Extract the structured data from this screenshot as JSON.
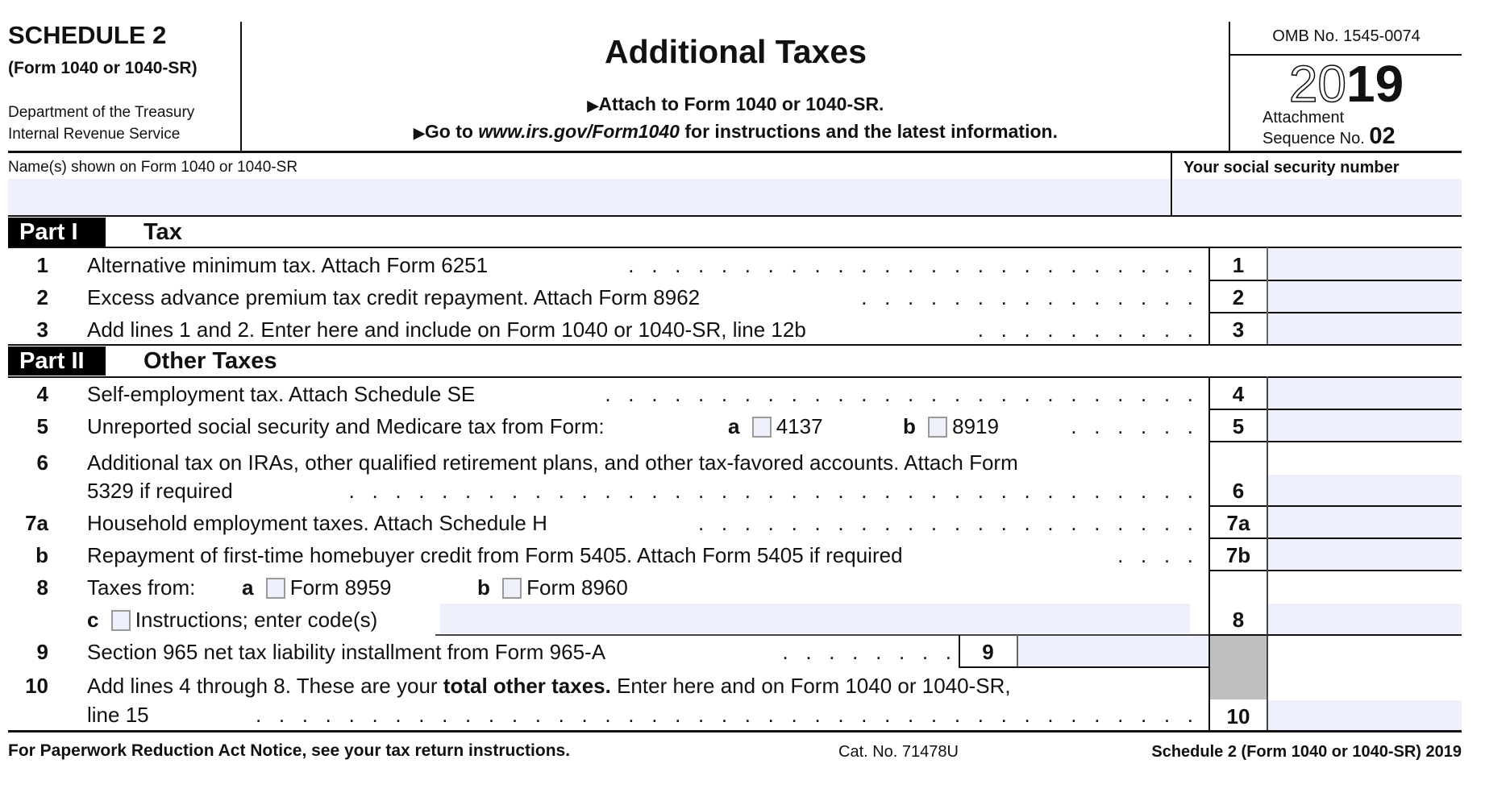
{
  "header": {
    "schedule": "SCHEDULE 2",
    "form_ref": "(Form 1040 or 1040-SR)",
    "dept_line1": "Department of the Treasury",
    "dept_line2": "Internal Revenue Service",
    "title": "Additional Taxes",
    "attach_line": "Attach to Form 1040 or 1040-SR.",
    "goto_prefix": "Go to ",
    "goto_url": "www.irs.gov/Form1040",
    "goto_suffix": " for instructions and the latest information.",
    "arrow_icon": "▶",
    "omb": "OMB No. 1545-0074",
    "year_outline": "20",
    "year_bold": "19",
    "attachment_label": "Attachment",
    "sequence_label": "Sequence No.",
    "sequence_no": "02"
  },
  "name_row": {
    "name_label": "Name(s) shown on Form 1040 or 1040-SR",
    "name_value": "",
    "ssn_label": "Your social security number",
    "ssn_value": ""
  },
  "part1": {
    "label": "Part I",
    "title": "Tax",
    "lines": [
      {
        "num": "1",
        "text": "Alternative minimum tax. Attach Form 6251",
        "box": "1",
        "value": ""
      },
      {
        "num": "2",
        "text": "Excess advance premium tax credit repayment. Attach Form 8962",
        "box": "2",
        "value": ""
      },
      {
        "num": "3",
        "text": "Add lines 1 and 2. Enter here and include on Form 1040 or 1040-SR, line 12b",
        "box": "3",
        "value": ""
      }
    ]
  },
  "part2": {
    "label": "Part II",
    "title": "Other Taxes",
    "line4": {
      "num": "4",
      "text": "Self-employment tax. Attach Schedule SE",
      "box": "4",
      "value": ""
    },
    "line5": {
      "num": "5",
      "text": "Unreported social security and Medicare tax from Form:",
      "a_label": "a",
      "a_form": "4137",
      "a_checked": false,
      "b_label": "b",
      "b_form": "8919",
      "b_checked": false,
      "box": "5",
      "value": ""
    },
    "line6": {
      "num": "6",
      "text1": "Additional tax on IRAs, other qualified retirement plans, and other tax-favored accounts. Attach Form",
      "text2": "5329 if required",
      "box": "6",
      "value": ""
    },
    "line7a": {
      "num": "7a",
      "text": "Household employment taxes. Attach Schedule H",
      "box": "7a",
      "value": ""
    },
    "line7b": {
      "num": "b",
      "text": "Repayment of first-time homebuyer credit from Form 5405. Attach Form 5405 if required",
      "box": "7b",
      "value": ""
    },
    "line8": {
      "num": "8",
      "text": "Taxes from:",
      "a_label": "a",
      "a_text": "Form 8959",
      "a_checked": false,
      "b_label": "b",
      "b_text": "Form 8960",
      "b_checked": false,
      "c_label": "c",
      "c_text": "Instructions; enter code(s)",
      "c_checked": false,
      "code_value": "",
      "box": "8",
      "value": ""
    },
    "line9": {
      "num": "9",
      "text": "Section 965 net tax liability installment from Form 965-A",
      "box": "9",
      "value": ""
    },
    "line10": {
      "num": "10",
      "text_a": "Add lines 4 through 8. These are your ",
      "text_bold": "total other taxes.",
      "text_b": " Enter here and on Form 1040 or 1040-SR,",
      "text2": "line 15",
      "box": "10",
      "value": ""
    }
  },
  "footer": {
    "paperwork": "For Paperwork Reduction Act Notice, see your tax return instructions.",
    "cat_no": "Cat. No. 71478U",
    "form_id": "Schedule 2 (Form 1040 or 1040-SR) 2019"
  },
  "colors": {
    "field_fill": "#eef1fb",
    "shaded_cell": "#bfbfbf",
    "ink": "#111111"
  }
}
